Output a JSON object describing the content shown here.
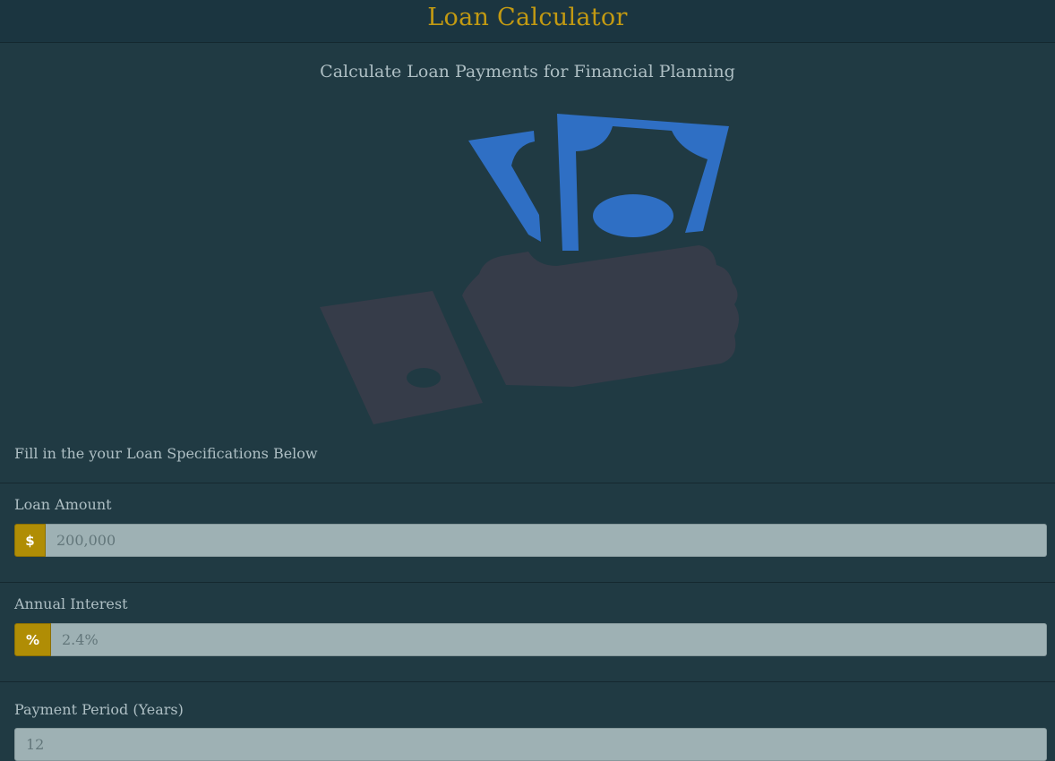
{
  "header": {
    "title": "Loan Calculator"
  },
  "subtitle": "Calculate Loan Payments for Financial Planning",
  "illustration": {
    "icon": "hand-giving-money-icon",
    "colors": {
      "bills": "#2f6fc4",
      "hand": "#363c49"
    }
  },
  "form": {
    "instructions": "Fill in the your Loan Specifications Below",
    "loan_amount": {
      "label": "Loan Amount",
      "addon": "$",
      "value": "200,000"
    },
    "annual_interest": {
      "label": "Annual Interest",
      "addon": "%",
      "value": "2.4%"
    },
    "payment_period": {
      "label": "Payment Period (Years)",
      "value": "12"
    }
  },
  "colors": {
    "background": "#203a43",
    "accent": "#c39a12",
    "addon": "#b08d05",
    "input_background": "#9eb1b4",
    "text": "#aebfc4"
  }
}
